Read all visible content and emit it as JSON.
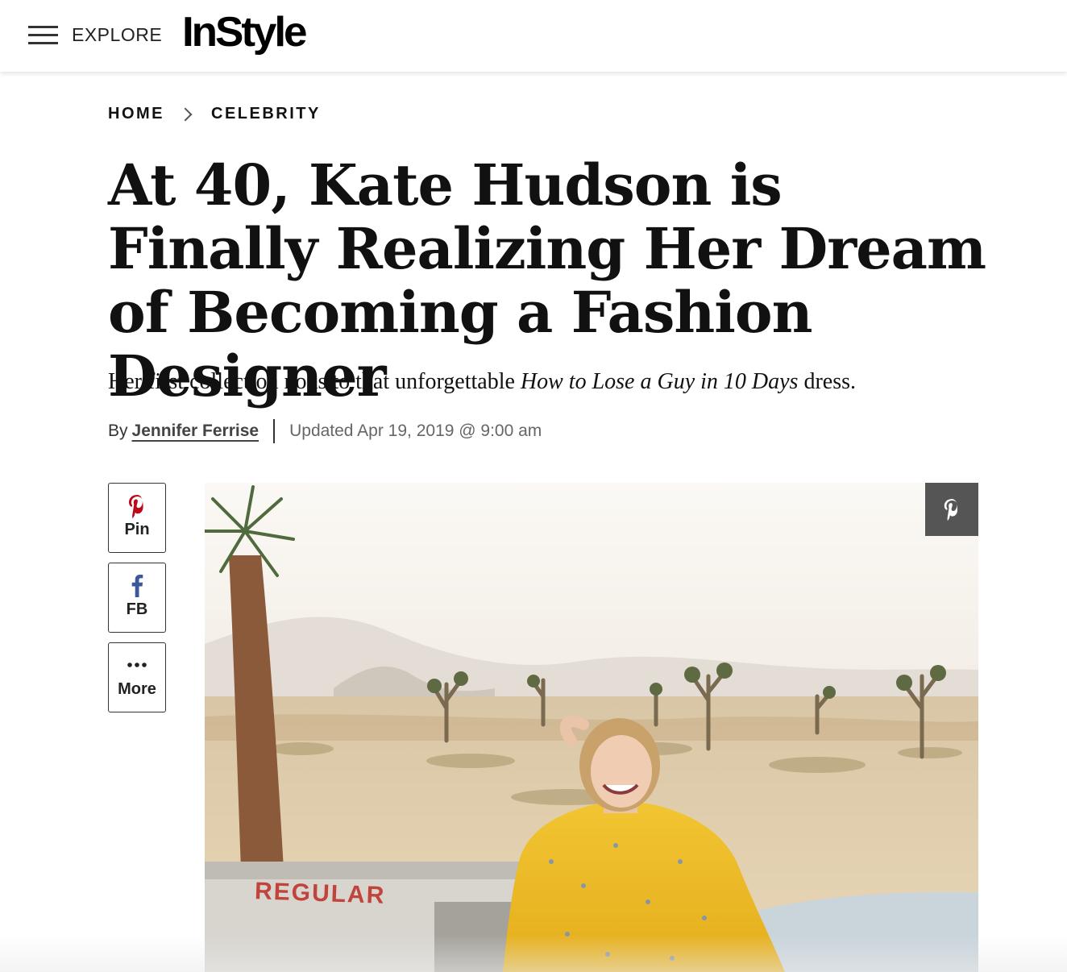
{
  "header": {
    "menu_label": "EXPLORE",
    "logo_text": "InStyle"
  },
  "breadcrumb": {
    "items": [
      "HOME",
      "CELEBRITY"
    ]
  },
  "article": {
    "title": "At 40, Kate Hudson is Finally Realizing Her Dream of Becoming a Fashion Designer",
    "dek_before": "Her first collection nods to that unforgettable ",
    "dek_italic": "How to Lose a Guy in 10 Days",
    "dek_after": " dress.",
    "by_prefix": "By",
    "author": "Jennifer Ferrise",
    "updated": "Updated Apr 19, 2019 @ 9:00 am"
  },
  "share": {
    "pin_label": "Pin",
    "fb_label": "FB",
    "more_label": "More"
  },
  "hero": {
    "pump_text": "REGULAR"
  },
  "colors": {
    "pinterest": "#bd081c",
    "facebook": "#3b5998",
    "overlay_button": "#555555"
  }
}
